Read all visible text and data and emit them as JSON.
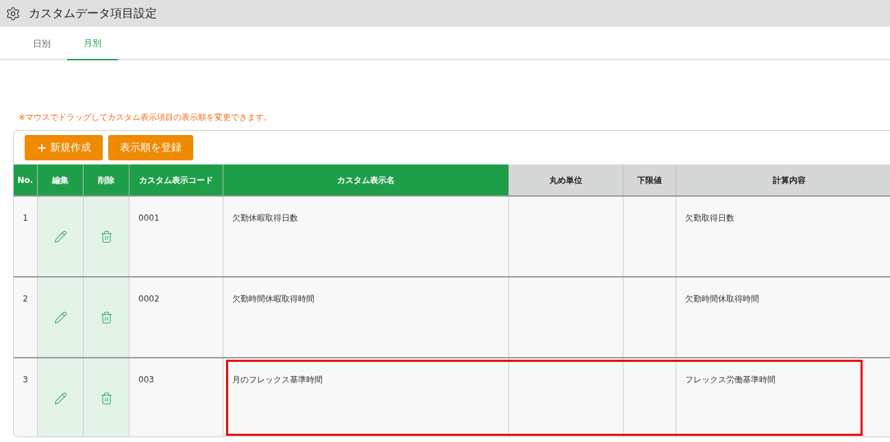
{
  "window": {
    "title": "カスタムデータ項目設定"
  },
  "tabs": [
    {
      "label": "日別",
      "selected": false
    },
    {
      "label": "月別",
      "selected": true
    }
  ],
  "notice": "※マウスでドラッグしてカスタム表示項目の表示順を変更できます。",
  "buttons": [
    {
      "label": "新規作成",
      "kind": "create"
    },
    {
      "label": "表示順を登録",
      "kind": "plain"
    }
  ],
  "table": {
    "columns": [
      {
        "label": "No.",
        "kind": "custom"
      },
      {
        "label": "編集",
        "kind": "custom"
      },
      {
        "label": "削除",
        "kind": "custom"
      },
      {
        "label": "カスタム表示コード",
        "kind": "custom"
      },
      {
        "label": "カスタム表示名",
        "kind": "custom"
      },
      {
        "label": "丸め単位",
        "kind": "source"
      },
      {
        "label": "下限値",
        "kind": "source"
      },
      {
        "label": "計算内容",
        "kind": "source"
      }
    ],
    "rows": [
      {
        "no": "1",
        "code": "0001",
        "name": "欠勤休暇取得日数",
        "rounding": "",
        "lower_limit": "",
        "calculation": "欠勤取得日数",
        "highlighted": false
      },
      {
        "no": "2",
        "code": "0002",
        "name": "欠勤時間休暇取得時間",
        "rounding": "",
        "lower_limit": "",
        "calculation": "欠勤時間休取得時間",
        "highlighted": false
      },
      {
        "no": "3",
        "code": "003",
        "name": "月のフレックス基準時間",
        "rounding": "",
        "lower_limit": "",
        "calculation": "フレックス労働基準時間",
        "highlighted": true
      }
    ]
  }
}
